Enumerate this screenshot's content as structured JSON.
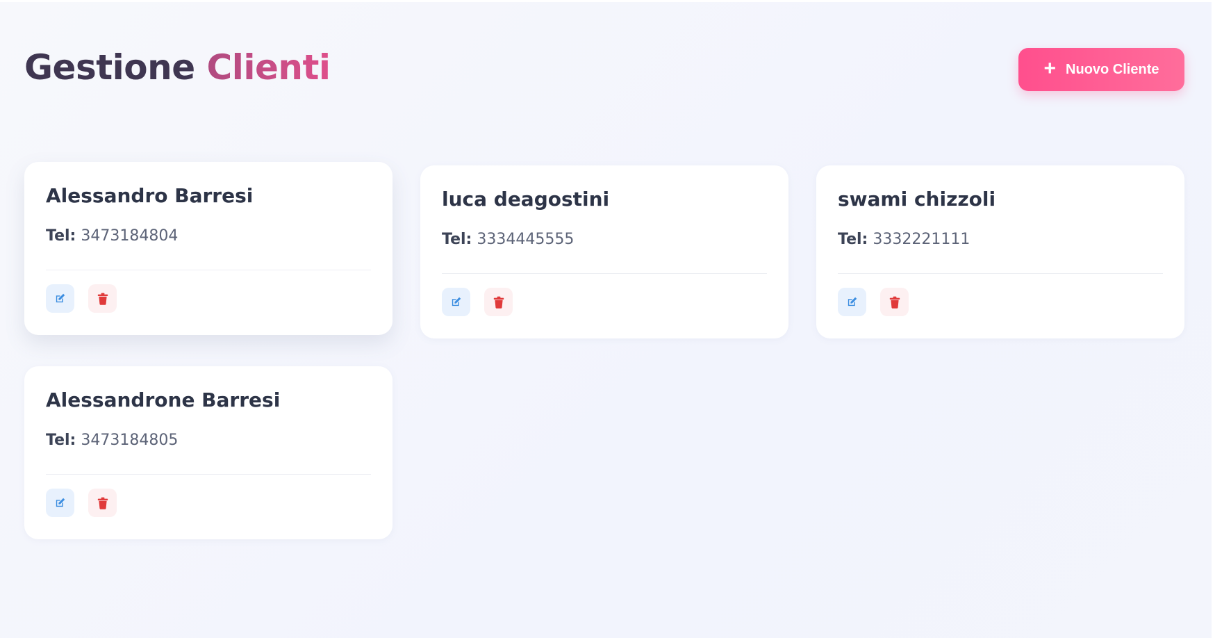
{
  "header": {
    "title_part1": "Gestione",
    "title_part2": "Clienti",
    "new_button_label": "Nuovo Cliente"
  },
  "clients": [
    {
      "name": "Alessandro Barresi",
      "tel_label": "Tel:",
      "tel": "3473184804"
    },
    {
      "name": "luca deagostini",
      "tel_label": "Tel:",
      "tel": "3334445555"
    },
    {
      "name": "swami chizzoli",
      "tel_label": "Tel:",
      "tel": "3332221111"
    },
    {
      "name": "Alessandrone Barresi",
      "tel_label": "Tel:",
      "tel": "3473184805"
    }
  ],
  "icons": {
    "add": "plus-icon",
    "edit": "edit-icon",
    "delete": "trash-icon"
  },
  "colors": {
    "accent": "#ff4f8d",
    "edit_icon": "#3b8de0",
    "delete_icon": "#e03a3a",
    "text_dark": "#2d3447"
  }
}
